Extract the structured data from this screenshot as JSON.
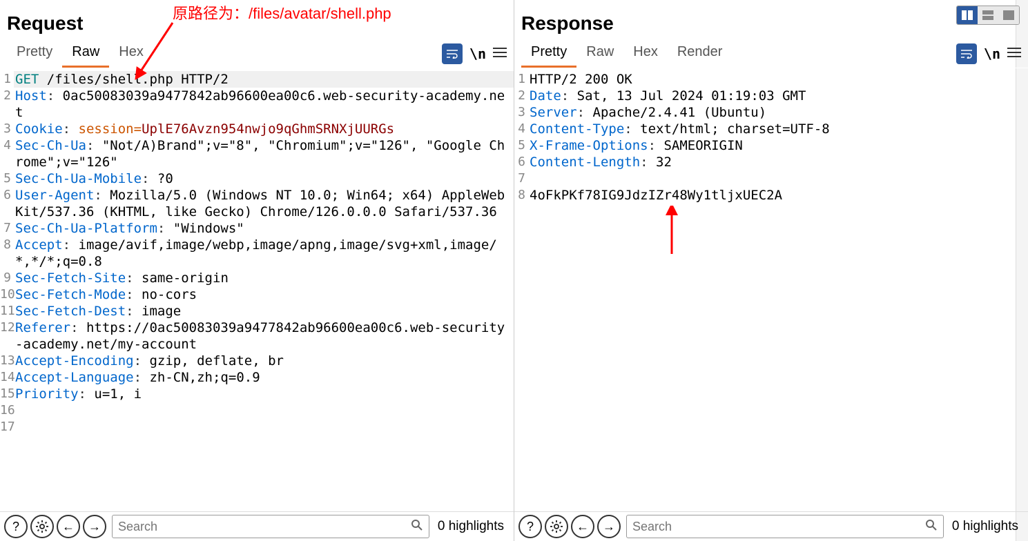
{
  "annotation": "原路径为：/files/avatar/shell.php",
  "request": {
    "title": "Request",
    "tabs": [
      "Pretty",
      "Raw",
      "Hex"
    ],
    "active_tab": "Raw",
    "lines": [
      {
        "n": "1",
        "segments": [
          {
            "c": "method",
            "t": "GET"
          },
          {
            "t": " /files/shell.php HTTP/2"
          }
        ],
        "hl": true
      },
      {
        "n": "2",
        "segments": [
          {
            "c": "hdr-name",
            "t": "Host"
          },
          {
            "c": "hdr-sep",
            "t": ":"
          },
          {
            "t": " 0ac50083039a9477842ab96600ea00c6.web-security-academy.net"
          }
        ]
      },
      {
        "n": "3",
        "segments": [
          {
            "c": "hdr-name",
            "t": "Cookie"
          },
          {
            "c": "hdr-sep",
            "t": ":"
          },
          {
            "t": " "
          },
          {
            "c": "cookie-val",
            "t": "session"
          },
          {
            "c": "cookie-val",
            "t": "="
          },
          {
            "c": "qs",
            "t": "UplE76Avzn954nwjo9qGhmSRNXjUURGs"
          }
        ]
      },
      {
        "n": "4",
        "segments": [
          {
            "c": "hdr-name",
            "t": "Sec-Ch-Ua"
          },
          {
            "c": "hdr-sep",
            "t": ":"
          },
          {
            "t": " \"Not/A)Brand\";v=\"8\", \"Chromium\";v=\"126\", \"Google Chrome\";v=\"126\""
          }
        ]
      },
      {
        "n": "5",
        "segments": [
          {
            "c": "hdr-name",
            "t": "Sec-Ch-Ua-Mobile"
          },
          {
            "c": "hdr-sep",
            "t": ":"
          },
          {
            "t": " ?0"
          }
        ]
      },
      {
        "n": "6",
        "segments": [
          {
            "c": "hdr-name",
            "t": "User-Agent"
          },
          {
            "c": "hdr-sep",
            "t": ":"
          },
          {
            "t": " Mozilla/5.0 (Windows NT 10.0; Win64; x64) AppleWebKit/537.36 (KHTML, like Gecko) Chrome/126.0.0.0 Safari/537.36"
          }
        ]
      },
      {
        "n": "7",
        "segments": [
          {
            "c": "hdr-name",
            "t": "Sec-Ch-Ua-Platform"
          },
          {
            "c": "hdr-sep",
            "t": ":"
          },
          {
            "t": " \"Windows\""
          }
        ]
      },
      {
        "n": "8",
        "segments": [
          {
            "c": "hdr-name",
            "t": "Accept"
          },
          {
            "c": "hdr-sep",
            "t": ":"
          },
          {
            "t": " image/avif,image/webp,image/apng,image/svg+xml,image/*,*/*;q=0.8"
          }
        ]
      },
      {
        "n": "9",
        "segments": [
          {
            "c": "hdr-name",
            "t": "Sec-Fetch-Site"
          },
          {
            "c": "hdr-sep",
            "t": ":"
          },
          {
            "t": " same-origin"
          }
        ]
      },
      {
        "n": "10",
        "segments": [
          {
            "c": "hdr-name",
            "t": "Sec-Fetch-Mode"
          },
          {
            "c": "hdr-sep",
            "t": ":"
          },
          {
            "t": " no-cors"
          }
        ]
      },
      {
        "n": "11",
        "segments": [
          {
            "c": "hdr-name",
            "t": "Sec-Fetch-Dest"
          },
          {
            "c": "hdr-sep",
            "t": ":"
          },
          {
            "t": " image"
          }
        ]
      },
      {
        "n": "12",
        "segments": [
          {
            "c": "hdr-name",
            "t": "Referer"
          },
          {
            "c": "hdr-sep",
            "t": ":"
          },
          {
            "t": " https://0ac50083039a9477842ab96600ea00c6.web-security-academy.net/my-account"
          }
        ]
      },
      {
        "n": "13",
        "segments": [
          {
            "c": "hdr-name",
            "t": "Accept-Encoding"
          },
          {
            "c": "hdr-sep",
            "t": ":"
          },
          {
            "t": " gzip, deflate, br"
          }
        ]
      },
      {
        "n": "14",
        "segments": [
          {
            "c": "hdr-name",
            "t": "Accept-Language"
          },
          {
            "c": "hdr-sep",
            "t": ":"
          },
          {
            "t": " zh-CN,zh;q=0.9"
          }
        ]
      },
      {
        "n": "15",
        "segments": [
          {
            "c": "hdr-name",
            "t": "Priority"
          },
          {
            "c": "hdr-sep",
            "t": ":"
          },
          {
            "t": " u=1, i"
          }
        ]
      },
      {
        "n": "16",
        "segments": []
      },
      {
        "n": "17",
        "segments": []
      }
    ],
    "search_placeholder": "Search",
    "highlights": "0 highlights"
  },
  "response": {
    "title": "Response",
    "tabs": [
      "Pretty",
      "Raw",
      "Hex",
      "Render"
    ],
    "active_tab": "Pretty",
    "lines": [
      {
        "n": "1",
        "segments": [
          {
            "t": "HTTP/2 200 OK"
          }
        ]
      },
      {
        "n": "2",
        "segments": [
          {
            "c": "hdr-name",
            "t": "Date"
          },
          {
            "c": "hdr-sep",
            "t": ":"
          },
          {
            "t": " Sat, 13 Jul 2024 01:19:03 GMT"
          }
        ]
      },
      {
        "n": "3",
        "segments": [
          {
            "c": "hdr-name",
            "t": "Server"
          },
          {
            "c": "hdr-sep",
            "t": ":"
          },
          {
            "t": " Apache/2.4.41 (Ubuntu)"
          }
        ]
      },
      {
        "n": "4",
        "segments": [
          {
            "c": "hdr-name",
            "t": "Content-Type"
          },
          {
            "c": "hdr-sep",
            "t": ":"
          },
          {
            "t": " text/html; charset=UTF-8"
          }
        ]
      },
      {
        "n": "5",
        "segments": [
          {
            "c": "hdr-name",
            "t": "X-Frame-Options"
          },
          {
            "c": "hdr-sep",
            "t": ":"
          },
          {
            "t": " SAMEORIGIN"
          }
        ]
      },
      {
        "n": "6",
        "segments": [
          {
            "c": "hdr-name",
            "t": "Content-Length"
          },
          {
            "c": "hdr-sep",
            "t": ":"
          },
          {
            "t": " 32"
          }
        ]
      },
      {
        "n": "7",
        "segments": []
      },
      {
        "n": "8",
        "segments": [
          {
            "t": "4oFkPKf78IG9JdzIZr48Wy1tljxUEC2A"
          }
        ]
      }
    ],
    "search_placeholder": "Search",
    "highlights": "0 highlights"
  },
  "icons": {
    "newline": "\\n",
    "help": "?",
    "back": "←",
    "forward": "→"
  }
}
